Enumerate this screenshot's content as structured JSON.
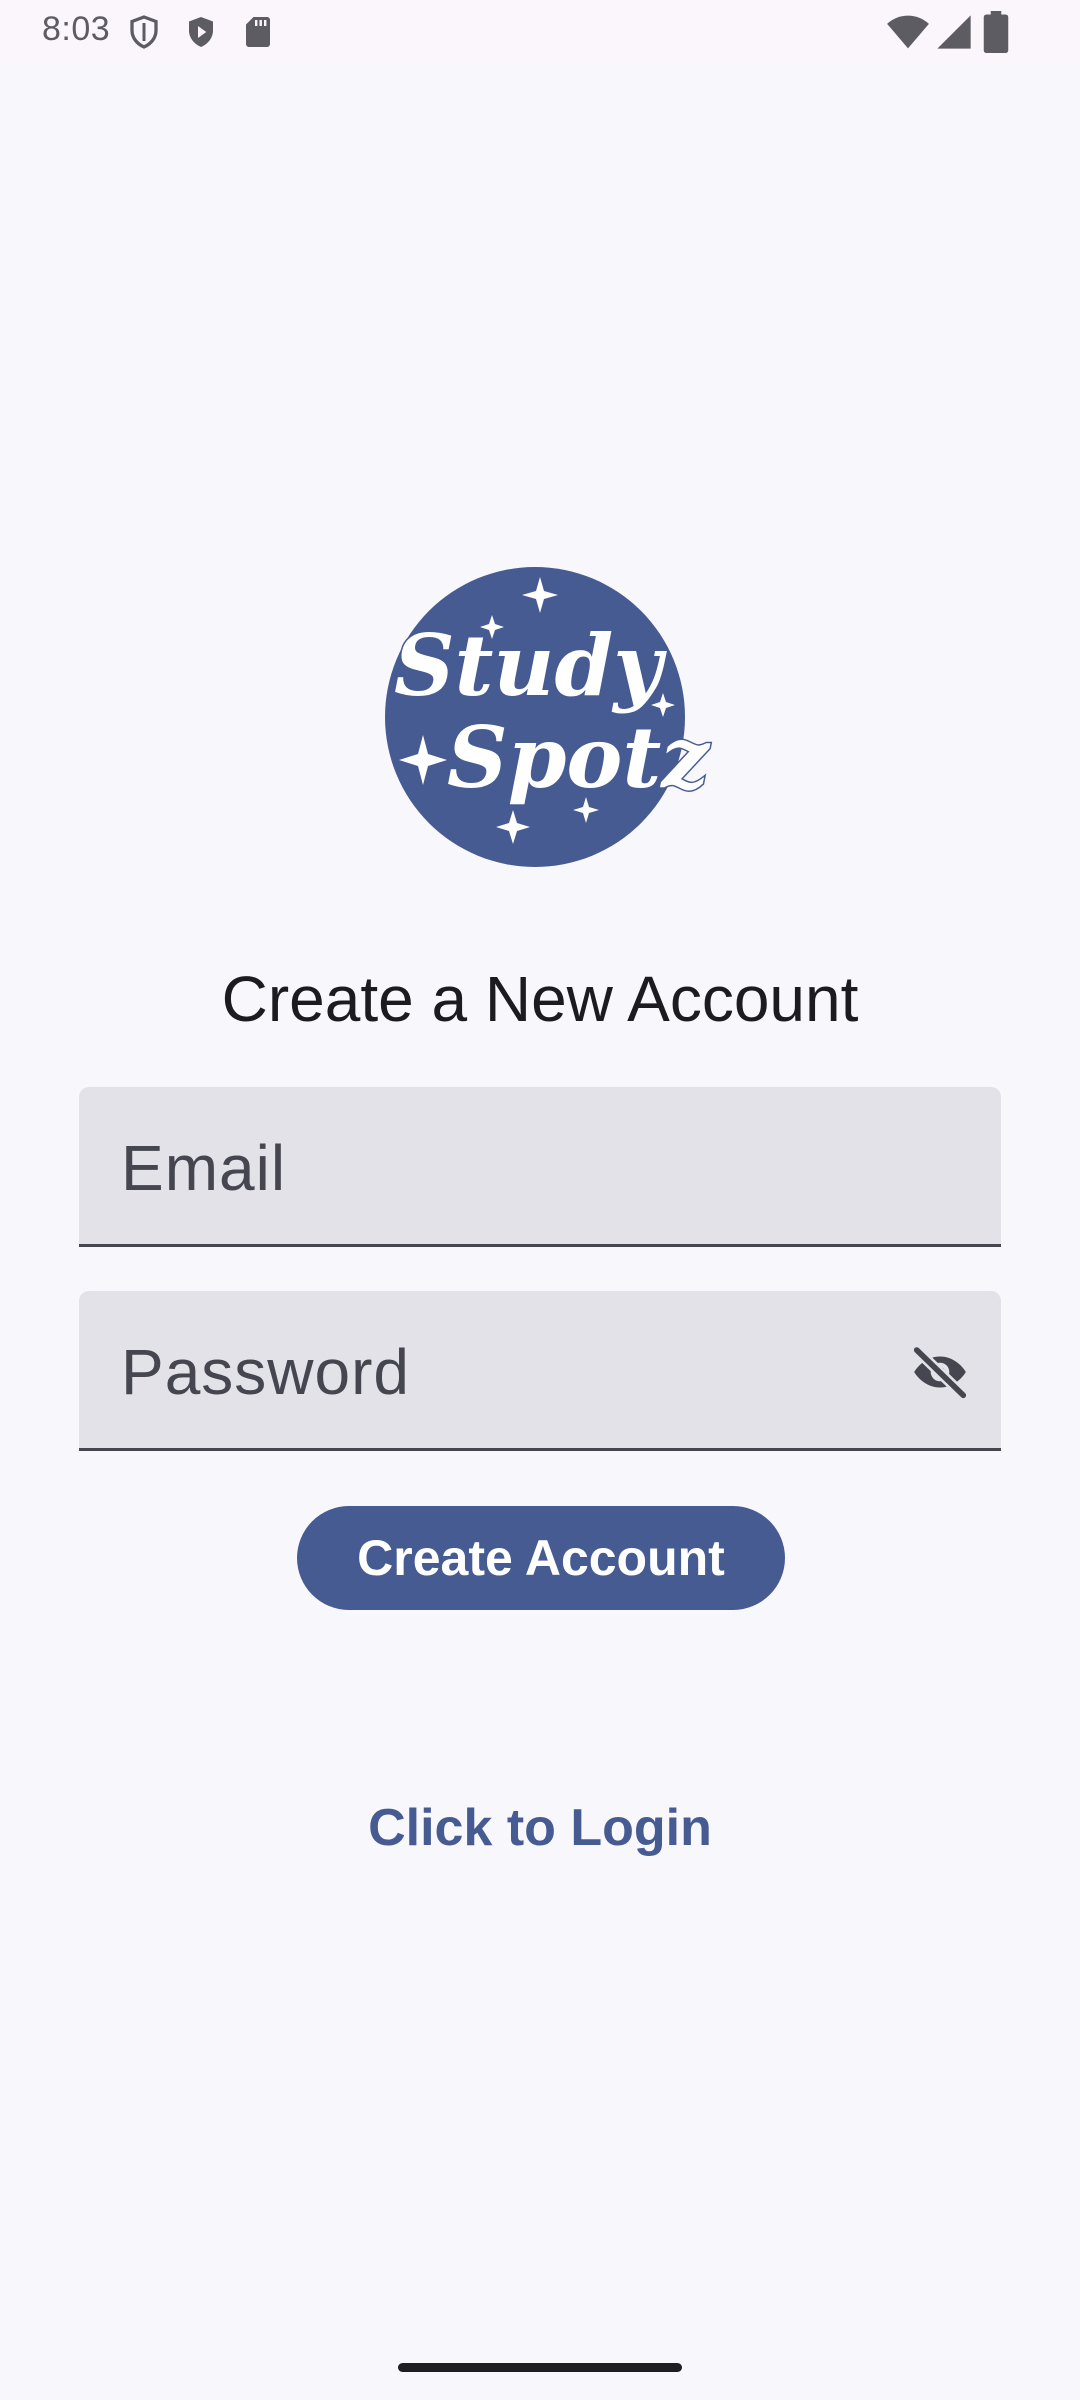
{
  "status_bar": {
    "time": "8:03",
    "icons_left": [
      "shield-outline-icon",
      "play-shield-icon",
      "sd-card-icon"
    ],
    "icons_right": [
      "wifi-icon",
      "signal-icon",
      "battery-icon"
    ]
  },
  "logo": {
    "line1": "Study",
    "line2": "Spotz",
    "color": "#465b92"
  },
  "page": {
    "title": "Create a New Account"
  },
  "form": {
    "email_label": "Email",
    "password_label": "Password",
    "password_toggle_icon": "visibility-off-icon",
    "submit_label": "Create Account"
  },
  "footer": {
    "login_link": "Click to Login"
  },
  "colors": {
    "accent": "#465b92",
    "field_bg": "#e3e2e8",
    "background": "#f8f7fc"
  }
}
